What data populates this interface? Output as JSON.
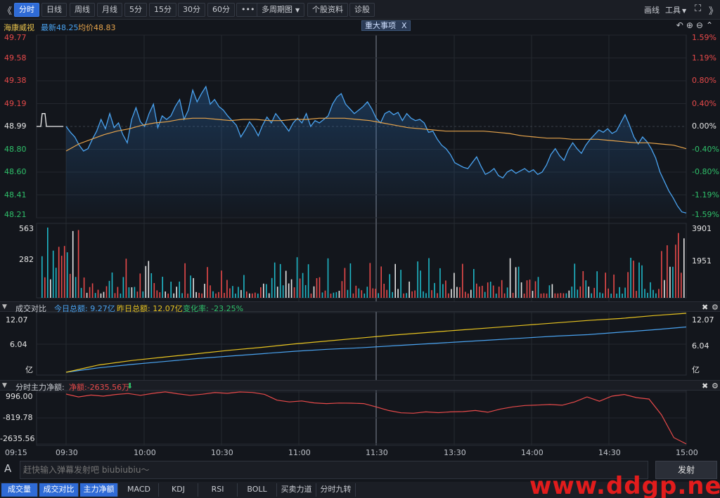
{
  "toolbar": {
    "nav_prev": "《",
    "periods": [
      "分时",
      "日线",
      "周线",
      "月线",
      "5分",
      "15分",
      "30分",
      "60分"
    ],
    "more": "•••",
    "multi_period": "多周期图",
    "stock_info": "个股资料",
    "diagnose": "诊股",
    "draw_line": "画线",
    "tools": "工具",
    "active_period": "分时"
  },
  "info": {
    "stock_name": "海康威视",
    "latest": "最新48.25",
    "avg": "均价48.83",
    "news_tag": "重大事项",
    "news_close": "X"
  },
  "price_axis": {
    "left": [
      "49.77",
      "49.58",
      "49.38",
      "49.19",
      "48.99",
      "48.80",
      "48.60",
      "48.41",
      "48.21"
    ],
    "right": [
      "1.59%",
      "1.19%",
      "0.80%",
      "0.40%",
      "0.00%",
      "-0.40%",
      "-0.80%",
      "-1.19%",
      "-1.59%"
    ],
    "prev_close": 48.99
  },
  "volume_axis": {
    "left": [
      "563",
      "282"
    ],
    "right": [
      "3901",
      "1951"
    ]
  },
  "turnover_panel": {
    "title": "成交对比",
    "today": "今日总额: 9.27亿",
    "yesterday": "昨日总额: 12.07亿",
    "change": "变化率: -23.25%",
    "axis_left": [
      "12.07",
      "6.04",
      "亿"
    ],
    "axis_right": [
      "12.07",
      "6.04",
      "亿"
    ]
  },
  "netflow_panel": {
    "title": "分时主力净额:",
    "net": "净额:-2635.56万",
    "arrow": "⬇",
    "axis": [
      "996.00",
      "-819.78",
      "-2635.56"
    ]
  },
  "time_axis": [
    "09:15",
    "09:30",
    "10:00",
    "10:30",
    "11:00",
    "11:30",
    "13:30",
    "14:00",
    "14:30",
    "15:00"
  ],
  "danmu": {
    "icon": "A",
    "placeholder": "赶快输入弹幕发射吧 biubiubiu～",
    "send": "发射"
  },
  "bottom_tabs": [
    "成交量",
    "成交对比",
    "主力净额",
    "MACD",
    "KDJ",
    "RSI",
    "BOLL",
    "买卖力道",
    "分时九转"
  ],
  "watermark": "www.ddgp.net",
  "colors": {
    "price_line": "#4aa3f0",
    "avg_line": "#e8a54c",
    "up": "#e84a4a",
    "down": "#1fb8c8",
    "today_amount": "#4aa3f0",
    "yesterday_amount": "#e8c420",
    "net_flow": "#e84a4a"
  },
  "chart_data": [
    {
      "type": "line",
      "title": "",
      "x_start": "09:30",
      "x_end": "15:00",
      "ylim": [
        48.21,
        49.77
      ],
      "series": [
        {
          "values": [
            48.99,
            48.94,
            48.9,
            48.83,
            48.78,
            48.8,
            48.88,
            48.95,
            49.05,
            48.97,
            49.1,
            48.98,
            49.02,
            48.92,
            48.85,
            49.05,
            49.15,
            49.03,
            48.99,
            49.1,
            49.18,
            48.98,
            49.08,
            49.05,
            49.08,
            49.16,
            49.22,
            49.05,
            49.13,
            49.3,
            49.2,
            49.27,
            49.33,
            49.18,
            49.22,
            49.16,
            49.13,
            49.08,
            49.04,
            49.0,
            48.9,
            48.96,
            49.03,
            48.98,
            48.91,
            49.0,
            49.07,
            49.02,
            49.1,
            49.05,
            49.0,
            48.95,
            49.02,
            49.06,
            49.02,
            49.1,
            48.99,
            49.04,
            49.02,
            49.05,
            49.08,
            49.18,
            49.24,
            49.27,
            49.18,
            49.14,
            49.1,
            49.13,
            49.16,
            49.2,
            49.14,
            49.06,
            49.02,
            49.1,
            49.12,
            49.09,
            49.11,
            49.04,
            49.1,
            49.06,
            49.04,
            49.05,
            49.02,
            48.94,
            48.95,
            48.88,
            48.83,
            48.8,
            48.75,
            48.68,
            48.66,
            48.64,
            48.63,
            48.68,
            48.73,
            48.65,
            48.58,
            48.6,
            48.63,
            48.57,
            48.55,
            48.6,
            48.62,
            48.59,
            48.61,
            48.63,
            48.6,
            48.62,
            48.58,
            48.6,
            48.66,
            48.75,
            48.8,
            48.74,
            48.7,
            48.79,
            48.85,
            48.8,
            48.76,
            48.83,
            48.88,
            48.92,
            48.96,
            48.94,
            48.97,
            48.93,
            48.95,
            49.02,
            49.09,
            49.0,
            48.9,
            48.84,
            48.9,
            48.86,
            48.8,
            48.72,
            48.6,
            48.52,
            48.44,
            48.38,
            48.31,
            48.26,
            48.25
          ]
        },
        {
          "values": [
            48.78,
            48.84,
            48.88,
            48.92,
            48.95,
            48.97,
            49.0,
            49.02,
            49.03,
            49.05,
            49.06,
            49.06,
            49.05,
            49.04,
            49.05,
            49.05,
            49.04,
            49.04,
            49.05,
            49.05,
            49.06,
            49.06,
            49.06,
            49.05,
            49.04,
            49.02,
            49.0,
            48.98,
            48.97,
            48.96,
            48.95,
            48.95,
            48.95,
            48.95,
            48.94,
            48.93,
            48.91,
            48.9,
            48.89,
            48.89,
            48.88,
            48.88,
            48.88,
            48.87,
            48.86,
            48.85,
            48.85,
            48.84,
            48.83,
            48.8
          ]
        }
      ]
    },
    {
      "type": "line",
      "title": "成交对比",
      "x_start": "09:30",
      "x_end": "15:00",
      "ylim": [
        0,
        12.07
      ],
      "series": [
        {
          "name": "今日总额",
          "values": [
            0,
            0.9,
            1.6,
            2.2,
            2.8,
            3.3,
            3.8,
            4.3,
            4.7,
            5.0,
            5.4,
            5.8,
            6.2,
            6.6,
            7.0,
            7.4,
            7.7,
            8.2,
            8.7,
            9.27
          ]
        },
        {
          "name": "昨日总额",
          "values": [
            0,
            1.5,
            2.4,
            3.1,
            3.8,
            4.5,
            5.1,
            5.8,
            6.4,
            7.0,
            7.6,
            8.1,
            8.6,
            9.1,
            9.6,
            10.1,
            10.6,
            11.0,
            11.6,
            12.07
          ]
        }
      ]
    },
    {
      "type": "line",
      "title": "分时主力净额",
      "x_start": "09:30",
      "x_end": "15:00",
      "ylim": [
        -2635.56,
        996.0
      ],
      "series": [
        {
          "values": [
            850,
            650,
            780,
            700,
            820,
            890,
            760,
            900,
            1000,
            870,
            760,
            840,
            950,
            900,
            996,
            960,
            830,
            420,
            300,
            370,
            230,
            180,
            220,
            210,
            180,
            -50,
            -300,
            -460,
            -490,
            -400,
            -450,
            -400,
            -380,
            -300,
            -420,
            -200,
            -50,
            50,
            80,
            120,
            70,
            300,
            650,
            350,
            700,
            820,
            600,
            500,
            -600,
            -2200,
            -2635.56
          ]
        }
      ]
    }
  ]
}
